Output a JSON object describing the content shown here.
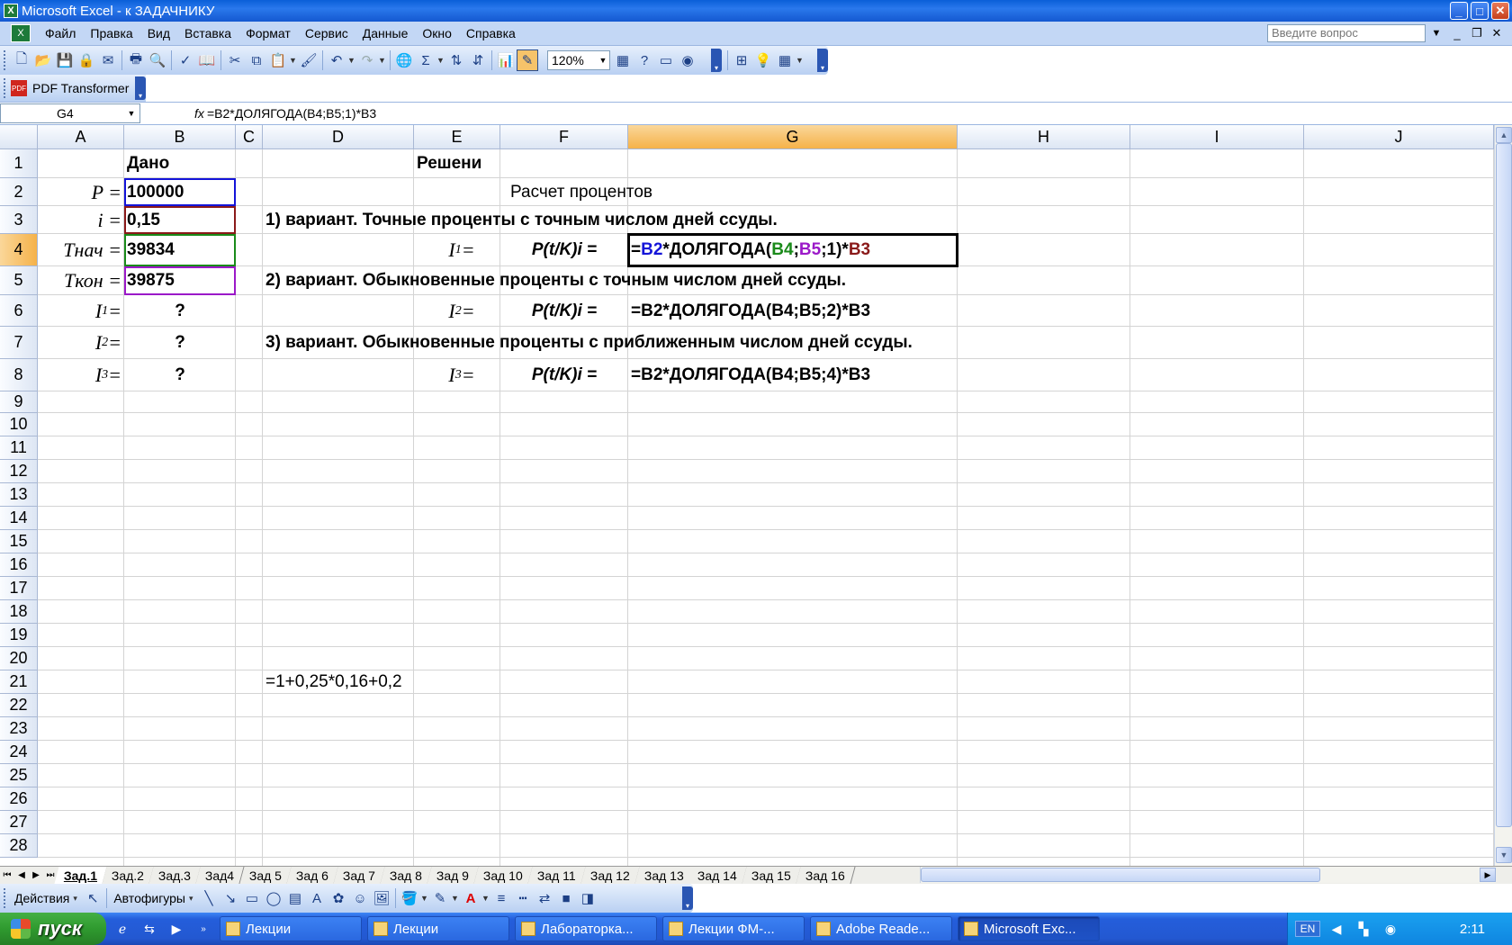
{
  "window": {
    "title": "Microsoft Excel - к ЗАДАЧНИКУ",
    "min": "_",
    "max": "□",
    "close": "✕"
  },
  "menu": {
    "items": [
      "Файл",
      "Правка",
      "Вид",
      "Вставка",
      "Формат",
      "Сервис",
      "Данные",
      "Окно",
      "Справка"
    ],
    "ask_placeholder": "Введите вопрос"
  },
  "toolbar": {
    "zoom": "120%"
  },
  "pdf_toolbar": {
    "label": "PDF Transformer"
  },
  "formula_bar": {
    "name_box": "G4",
    "fx": "fx",
    "formula": "=B2*ДОЛЯГОДА(B4;B5;1)*B3"
  },
  "columns": [
    "A",
    "B",
    "C",
    "D",
    "E",
    "F",
    "G",
    "H",
    "I",
    "J"
  ],
  "selected_column": "G",
  "rows": [
    "1",
    "2",
    "3",
    "4",
    "5",
    "6",
    "7",
    "8",
    "9",
    "10",
    "11",
    "12",
    "13",
    "14",
    "15",
    "16",
    "17",
    "18",
    "19",
    "20",
    "21",
    "22",
    "23",
    "24",
    "25",
    "26",
    "27",
    "28"
  ],
  "selected_row": "4",
  "cells": {
    "B1": "Дано",
    "E1": "Решени",
    "F2": "Расчет процентов",
    "A2": "P =",
    "B2": "100000",
    "A3": "i =",
    "B3": "0,15",
    "D3": "1) вариант. Точные проценты с точным числом дней ссуды.",
    "A4": "Tнач =",
    "B4": "39834",
    "E4_main": "I",
    "E4_sub": "1",
    "E4_eq": " =",
    "F4": "P(t/K)i =",
    "G4": {
      "p1": "=",
      "p2": "B2",
      "p3": "*ДОЛЯГОДА(",
      "p4": "B4",
      "p5": ";",
      "p6": "B5",
      "p7": ";1)*",
      "p8": "B3"
    },
    "A5": "Tкон =",
    "B5": "39875",
    "D5": "2) вариант. Обыкновенные проценты с точным числом дней ссуды.",
    "A6_main": "I",
    "A6_sub": "1",
    "A6_eq": " =",
    "B6": "?",
    "E6_main": "I",
    "E6_sub": "2",
    "E6_eq": " =",
    "F6": "P(t/K)i =",
    "G6": "=B2*ДОЛЯГОДА(B4;B5;2)*B3",
    "A7_main": "I",
    "A7_sub": "2",
    "A7_eq": " =",
    "B7": "?",
    "D7": "3) вариант. Обыкновенные проценты с приближенным числом дней ссуды.",
    "A8_main": "I",
    "A8_sub": "3",
    "A8_eq": " =",
    "B8": "?",
    "E8_main": "I",
    "E8_sub": "3",
    "E8_eq": " =",
    "F8": "P(t/K)i =",
    "G8": "=B2*ДОЛЯГОДА(B4;B5;4)*B3",
    "D21": "=1+0,25*0,16+0,2"
  },
  "sheet_tabs": [
    "Зад.1",
    "Зад.2",
    "Зад.3",
    "Зад4",
    "Зад 5",
    "Зад 6",
    "Зад 7",
    "Зад 8",
    "Зад 9",
    "Зад 10",
    "Зад 11",
    "Зад 12",
    "Зад 13",
    "Зад 14",
    "Зад 15",
    "Зад 16"
  ],
  "active_tab": "Зад.1",
  "drawing": {
    "actions": "Действия",
    "autoshapes": "Автофигуры"
  },
  "taskbar": {
    "start": "пуск",
    "tasks": [
      "Лекции",
      "Лекции",
      "Лабораторка...",
      "Лекции ФМ-...",
      "Adobe Reade...",
      "Microsoft Exc..."
    ],
    "lang": "EN",
    "clock": "2:11"
  },
  "colors": {
    "ref_b2": "#1414d8",
    "ref_b4": "#1a8a1a",
    "ref_b5": "#9b19c8",
    "ref_b3": "#8a1a1a",
    "selected_header": "#f5b249"
  }
}
